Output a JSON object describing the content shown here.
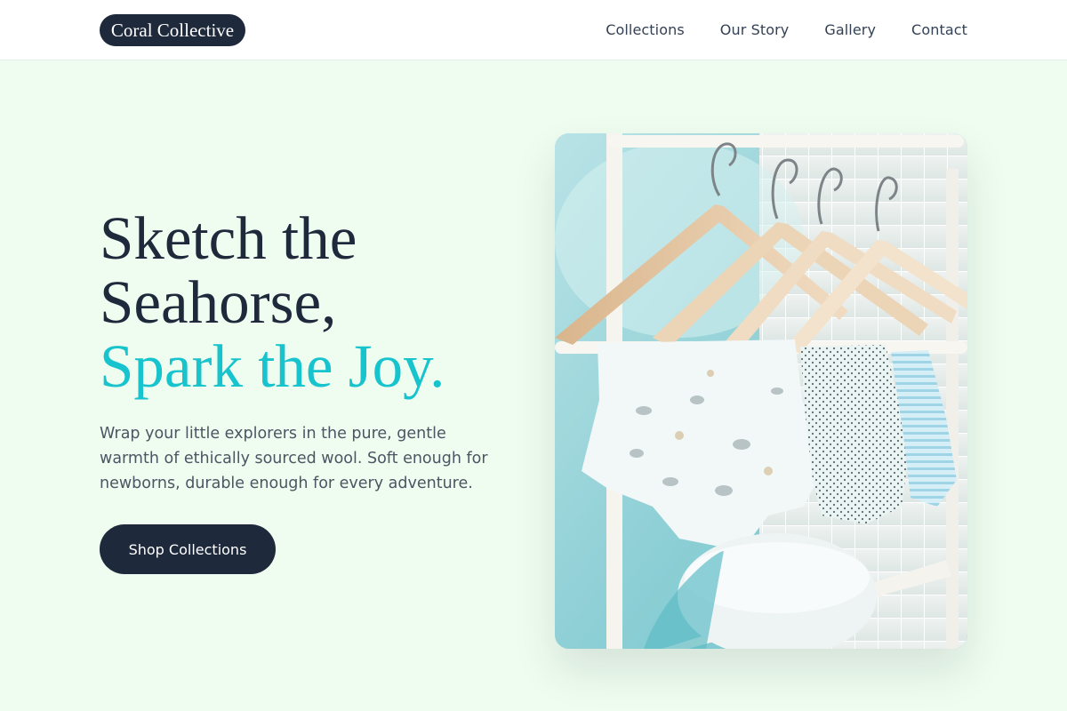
{
  "header": {
    "logo": "Coral Collective",
    "nav": [
      {
        "label": "Collections"
      },
      {
        "label": "Our Story"
      },
      {
        "label": "Gallery"
      },
      {
        "label": "Contact"
      }
    ]
  },
  "hero": {
    "headline_line1": "Sketch the",
    "headline_line2": "Seahorse,",
    "headline_accent": "Spark the Joy.",
    "body": "Wrap your little explorers in the pure, gentle warmth of ethically sourced wool. Soft enough for newborns, durable enough for every adventure.",
    "cta_label": "Shop Collections",
    "image_alt": "Baby clothes hanging on wooden hangers on a white rack"
  },
  "colors": {
    "background": "#effdf0",
    "navy": "#1e293b",
    "accent": "#17c3cc",
    "body_text": "#4b5563"
  }
}
